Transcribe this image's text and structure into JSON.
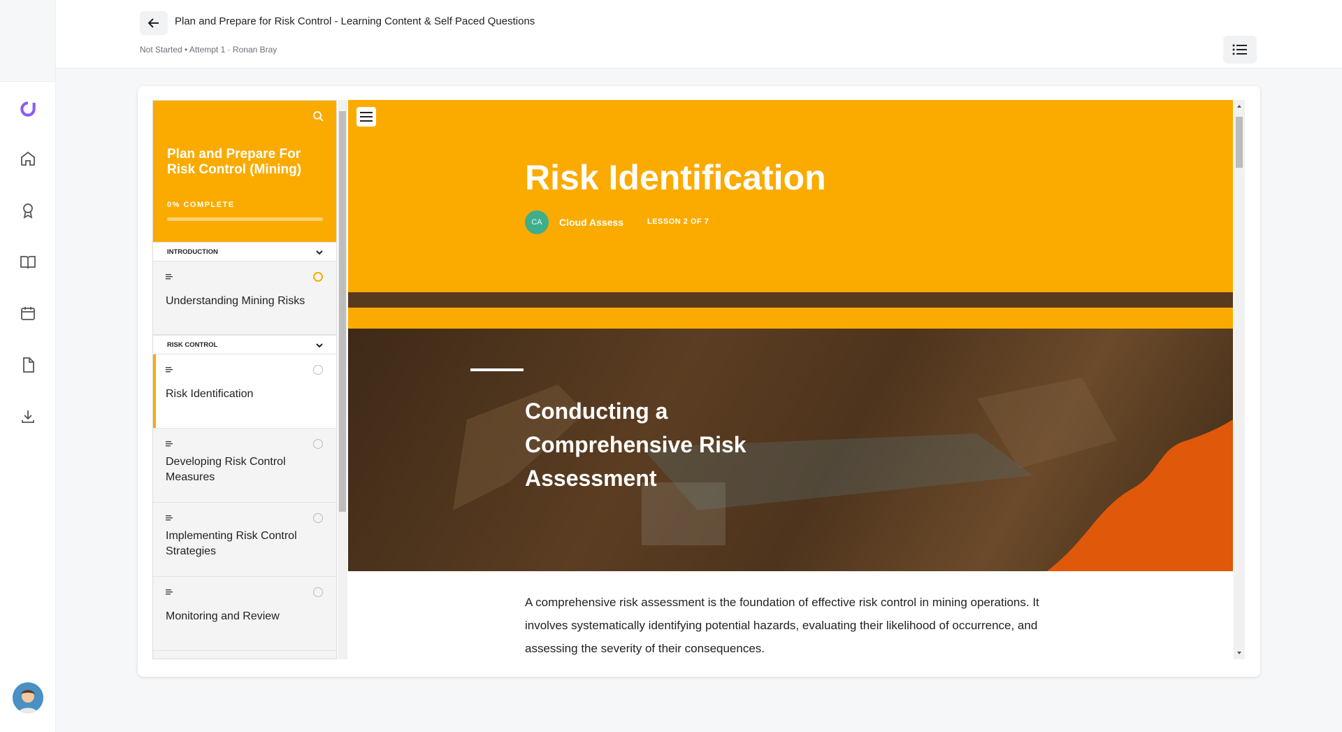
{
  "header": {
    "title": "Plan and Prepare for Risk Control - Learning Content & Self Paced Questions",
    "meta": "Not Started • Attempt 1 · Ronan Bray"
  },
  "rail": {
    "icons": [
      "brand-logo-icon",
      "home-icon",
      "award-icon",
      "book-icon",
      "calendar-icon",
      "file-icon",
      "download-icon"
    ]
  },
  "course": {
    "title": "Plan and Prepare For Risk Control (Mining)",
    "progress_label": "0% COMPLETE",
    "progress": 0,
    "sections": [
      {
        "label": "INTRODUCTION",
        "lessons": [
          {
            "title": "Understanding Mining Risks",
            "status": "in-progress"
          }
        ]
      },
      {
        "label": "RISK CONTROL",
        "lessons": [
          {
            "title": "Risk Identification",
            "status": "not-started",
            "active": true
          },
          {
            "title": "Developing Risk Control Measures",
            "status": "not-started"
          },
          {
            "title": "Implementing Risk Control Strategies",
            "status": "not-started"
          },
          {
            "title": "Monitoring and Review",
            "status": "not-started"
          }
        ]
      }
    ]
  },
  "lesson": {
    "title": "Risk Identification",
    "author_initials": "CA",
    "author": "Cloud Assess",
    "lesson_count": "LESSON 2 OF 7",
    "image_heading": "Conducting a Comprehensive Risk Assessment",
    "body": "A comprehensive risk assessment is the foundation of effective risk control in mining operations. It involves systematically identifying potential hazards, evaluating their likelihood of occurrence, and assessing the severity of their consequences."
  },
  "colors": {
    "accent": "#fbab00",
    "accent_orange": "#e0580a",
    "dark_brown": "#5a3a1e",
    "brand_purple": "#8b5cf6",
    "author_avatar": "#3fae8c"
  }
}
